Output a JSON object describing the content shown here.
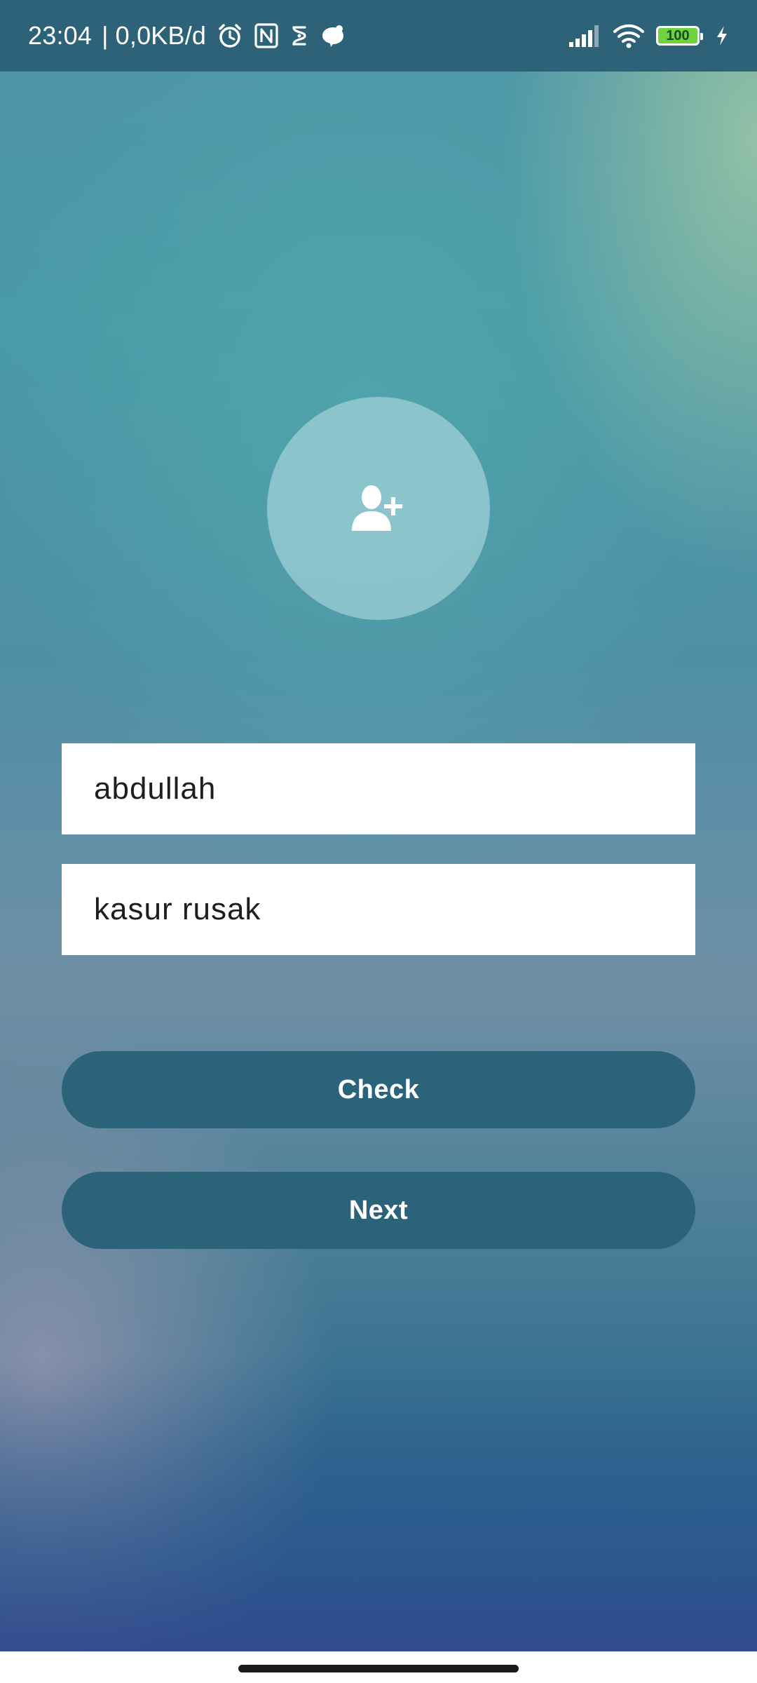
{
  "status_bar": {
    "time": "23:04",
    "separator": "|",
    "network_speed": "0,0KB/d",
    "left_icons": [
      "alarm-icon",
      "nfc-icon",
      "notification-app-icon",
      "notification-app-icon-2"
    ],
    "right_icons": [
      "signal-icon",
      "wifi-icon",
      "battery-icon",
      "charging-icon"
    ],
    "battery_level": "100",
    "battery_color": "#6fd33b"
  },
  "avatar": {
    "icon": "add-user-icon"
  },
  "form": {
    "name_value": "abdullah",
    "description_value": "kasur rusak"
  },
  "buttons": {
    "check_label": "Check",
    "next_label": "Next"
  },
  "colors": {
    "button_background": "#2b637b",
    "status_bar_background": "#2d6278"
  }
}
